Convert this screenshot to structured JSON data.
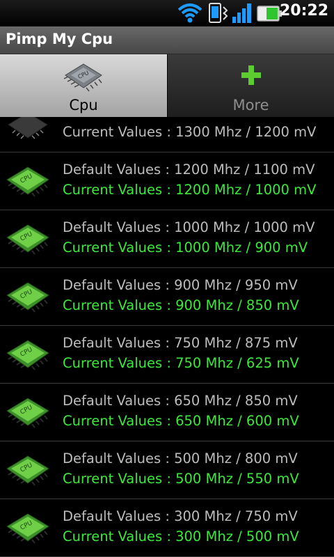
{
  "status_bar": {
    "time": "20:22",
    "icons": [
      "wifi-icon",
      "phone-sync-icon",
      "signal-icon",
      "battery-icon"
    ],
    "battery_color": "#2ec52e"
  },
  "app": {
    "title": "Pimp My Cpu"
  },
  "tabs": [
    {
      "label": "Cpu",
      "icon": "cpu-chip-icon",
      "selected": true
    },
    {
      "label": "More",
      "icon": "plus-icon",
      "selected": false
    }
  ],
  "list": {
    "partial_item": {
      "current": "Current Values : 1300 Mhz / 1200 mV"
    },
    "items": [
      {
        "default": "Default Values : 1200 Mhz / 1100 mV",
        "current": "Current Values : 1200 Mhz / 1000 mV"
      },
      {
        "default": "Default Values : 1000 Mhz / 1000 mV",
        "current": "Current Values : 1000 Mhz / 900 mV"
      },
      {
        "default": "Default Values : 900 Mhz / 950 mV",
        "current": "Current Values : 900 Mhz / 850 mV"
      },
      {
        "default": "Default Values : 750 Mhz / 875 mV",
        "current": "Current Values : 750 Mhz / 625 mV"
      },
      {
        "default": "Default Values : 650 Mhz / 850 mV",
        "current": "Current Values : 650 Mhz / 600 mV"
      },
      {
        "default": "Default Values : 500 Mhz / 800 mV",
        "current": "Current Values : 500 Mhz / 550 mV"
      },
      {
        "default": "Default Values : 300 Mhz / 750 mV",
        "current": "Current Values : 300 Mhz / 500 mV"
      }
    ]
  },
  "colors": {
    "current_value_green": "#3ce83c",
    "default_value_gray": "#bdbdbd",
    "selected_tab_bg": "#c8c8c8",
    "chip_green": "#5cc23a"
  }
}
